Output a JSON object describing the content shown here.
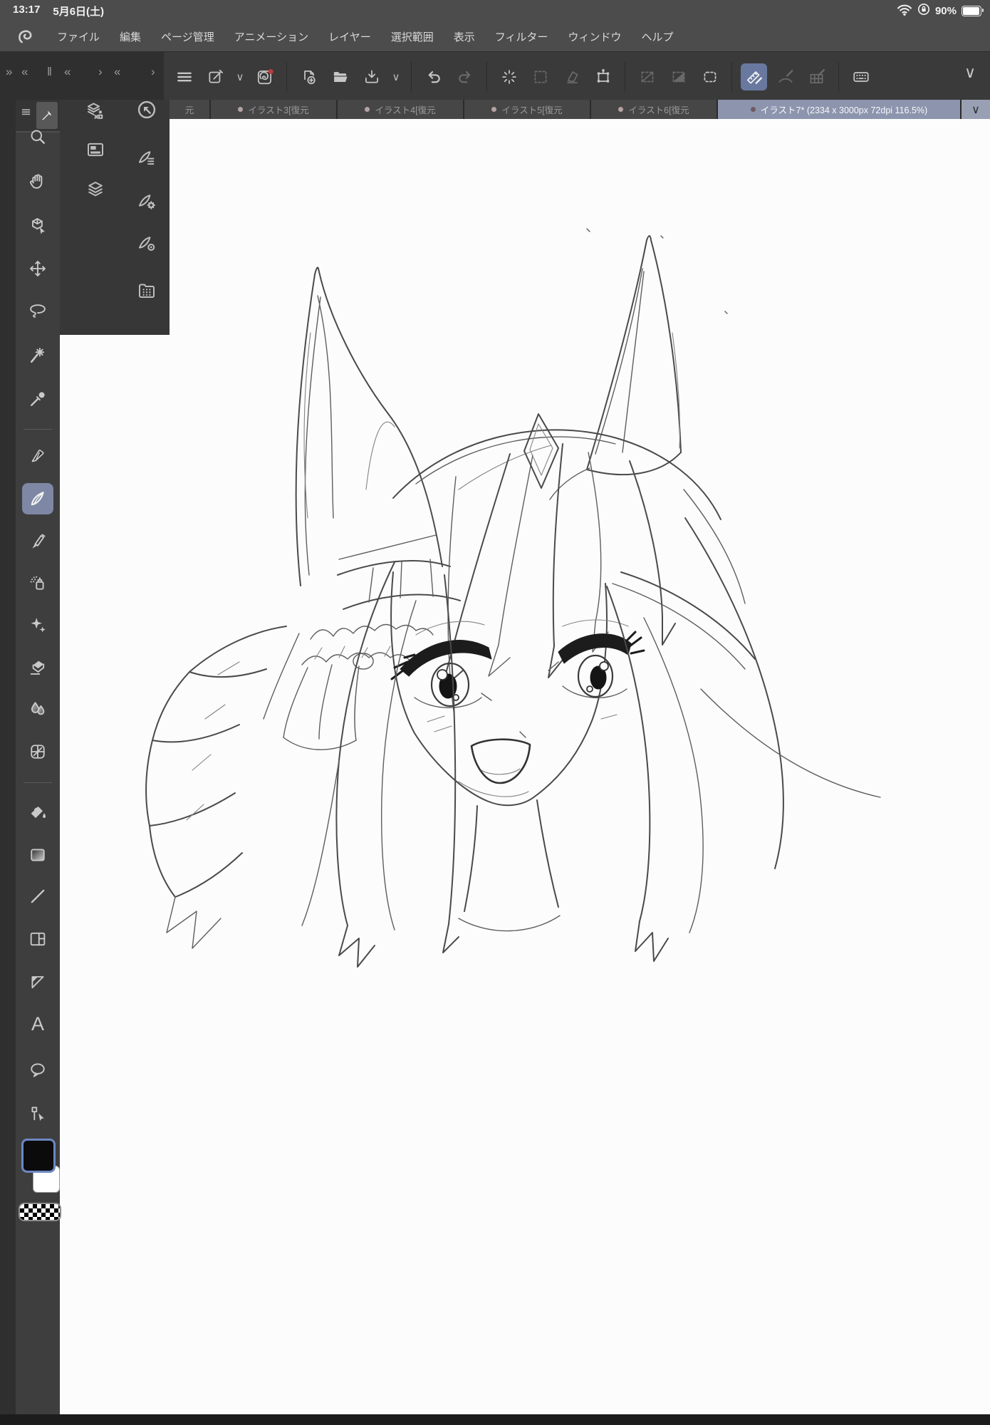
{
  "status_bar": {
    "time": "13:17",
    "date": "5月6日(土)",
    "battery_percent": "90%",
    "icons": [
      "wifi",
      "rotation-lock",
      "battery"
    ]
  },
  "menu_bar": {
    "items": [
      "ファイル",
      "編集",
      "ページ管理",
      "アニメーション",
      "レイヤー",
      "選択範囲",
      "表示",
      "フィルター",
      "ウィンドウ",
      "ヘルプ"
    ]
  },
  "command_bar": {
    "dock_chevrons": [
      "»",
      "«",
      "‖",
      "«",
      "›",
      "«",
      "›"
    ],
    "caret_glyph": "∨",
    "collapse_glyph": "∨",
    "items": [
      {
        "name": "main-menu",
        "enabled": true
      },
      {
        "name": "pen-settings",
        "enabled": true
      },
      {
        "name": "clip-studio-home",
        "enabled": true,
        "notification": true
      },
      {
        "name": "new-canvas",
        "enabled": true
      },
      {
        "name": "open-file",
        "enabled": true
      },
      {
        "name": "save-file",
        "enabled": true
      },
      {
        "name": "undo",
        "enabled": true
      },
      {
        "name": "redo",
        "enabled": false
      },
      {
        "name": "clear",
        "enabled": true
      },
      {
        "name": "deselect",
        "enabled": false
      },
      {
        "name": "erase-outside-selection",
        "enabled": false
      },
      {
        "name": "scale-rotate",
        "enabled": true
      },
      {
        "name": "selection-launcher-off",
        "enabled": false
      },
      {
        "name": "invert-selection",
        "enabled": false
      },
      {
        "name": "selection-border",
        "enabled": true
      },
      {
        "name": "snap-to-ruler",
        "enabled": true,
        "active": true
      },
      {
        "name": "snap-to-special-ruler",
        "enabled": false
      },
      {
        "name": "snap-to-grid",
        "enabled": false
      },
      {
        "name": "shortcut-bar",
        "enabled": true
      },
      {
        "name": "collapse-command-bar",
        "enabled": true
      }
    ]
  },
  "tab_bar": {
    "overflow_glyph": "∨",
    "tabs": [
      {
        "label": "元",
        "state": "clipped"
      },
      {
        "label": "イラスト3[復元",
        "state": "inactive"
      },
      {
        "label": "イラスト4[復元",
        "state": "inactive"
      },
      {
        "label": "イラスト5[復元",
        "state": "inactive"
      },
      {
        "label": "イラスト6[復元",
        "state": "inactive"
      },
      {
        "label": "イラスト7* (2334 x 3000px 72dpi 116.5%)",
        "state": "active"
      }
    ]
  },
  "tool_palette": {
    "selected_tool": "pencil",
    "text_tool_glyph": "A",
    "tools": [
      "zoom",
      "hand",
      "operation",
      "move-layer",
      "selection",
      "auto-select",
      "eyedropper",
      "pen",
      "pencil",
      "brush",
      "airbrush",
      "decoration",
      "eraser",
      "blend",
      "liquify",
      "fill",
      "gradient",
      "figure",
      "frame-border",
      "stream-line",
      "text",
      "balloon",
      "correct-line"
    ],
    "colors": {
      "main": "#0B0B0B",
      "sub": "#FFFFFF",
      "transparent": "checker"
    }
  },
  "palette_dock": {
    "left_column": [
      "quick-access",
      "layer-property",
      "layers"
    ],
    "right_column": [
      "reset-display",
      "sub-tool",
      "tool-property",
      "brush-size",
      "material"
    ]
  },
  "canvas": {
    "content": "rough pencil sketch of a horse-eared anime girl with a frilled ear ribbon, large eyes and open smile"
  },
  "colors": {
    "active_tab": "#8D95AE",
    "selected_tool_bg": "#7E88A5",
    "active_command_bg": "#68789F",
    "notification_dot": "#C23B3B",
    "canvas_bg": "#FCFCFC",
    "chrome_dark": "#3A3A3A",
    "chrome_darker": "#2F2F2F",
    "menu_bg": "#4C4C4C"
  }
}
